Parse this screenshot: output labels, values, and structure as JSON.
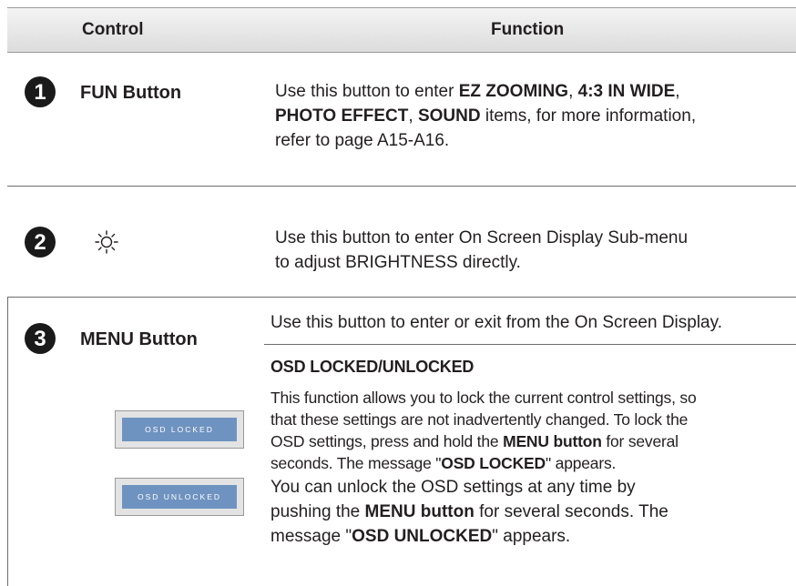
{
  "header": {
    "control": "Control",
    "function": "Function"
  },
  "rows": [
    {
      "number": "1",
      "control": "FUN Button",
      "description": [
        [
          {
            "t": "Use this button to enter ",
            "b": false
          },
          {
            "t": "EZ ZOOMING",
            "b": true
          },
          {
            "t": ", ",
            "b": false
          },
          {
            "t": "4:3 IN WIDE",
            "b": true
          },
          {
            "t": ",",
            "b": false
          }
        ],
        [
          {
            "t": "PHOTO EFFECT",
            "b": true
          },
          {
            "t": ", ",
            "b": false
          },
          {
            "t": "SOUND",
            "b": true
          },
          {
            "t": " items, for more information,",
            "b": false
          }
        ],
        [
          {
            "t": "refer to page A15-A16.",
            "b": false
          }
        ]
      ]
    },
    {
      "number": "2",
      "control_icon": "brightness-sun-icon",
      "description": [
        [
          {
            "t": "Use this button to enter On Screen Display Sub-menu",
            "b": false
          }
        ],
        [
          {
            "t": "to adjust BRIGHTNESS directly.",
            "b": false
          }
        ]
      ]
    },
    {
      "number": "3",
      "control": "MENU Button",
      "description": [
        [
          {
            "t": "Use this button to enter or exit from the On Screen Display.",
            "b": false
          }
        ]
      ],
      "subsection": {
        "title": "OSD LOCKED/UNLOCKED",
        "paragraph1": [
          [
            {
              "t": "This function allows you to lock the current control settings, so",
              "b": false
            }
          ],
          [
            {
              "t": "that these settings are not inadvertently changed. To lock the",
              "b": false
            }
          ],
          [
            {
              "t": "OSD settings, press and hold the ",
              "b": false
            },
            {
              "t": "MENU button",
              "b": true
            },
            {
              "t": " for several",
              "b": false
            }
          ],
          [
            {
              "t": "seconds. The message \"",
              "b": false
            },
            {
              "t": "OSD LOCKED",
              "b": true
            },
            {
              "t": "\" appears.",
              "b": false
            }
          ]
        ],
        "paragraph2": [
          [
            {
              "t": "You can unlock the OSD settings at any time by",
              "b": false
            }
          ],
          [
            {
              "t": "pushing the ",
              "b": false
            },
            {
              "t": "MENU button",
              "b": true
            },
            {
              "t": " for several seconds. The",
              "b": false
            }
          ],
          [
            {
              "t": "message \"",
              "b": false
            },
            {
              "t": "OSD UNLOCKED",
              "b": true
            },
            {
              "t": "\" appears.",
              "b": false
            }
          ]
        ]
      },
      "osd_images": [
        "OSD LOCKED",
        "OSD UNLOCKED"
      ]
    }
  ],
  "colors": {
    "osd_bar": "#6f93c0",
    "badge": "#1a1a1a"
  }
}
